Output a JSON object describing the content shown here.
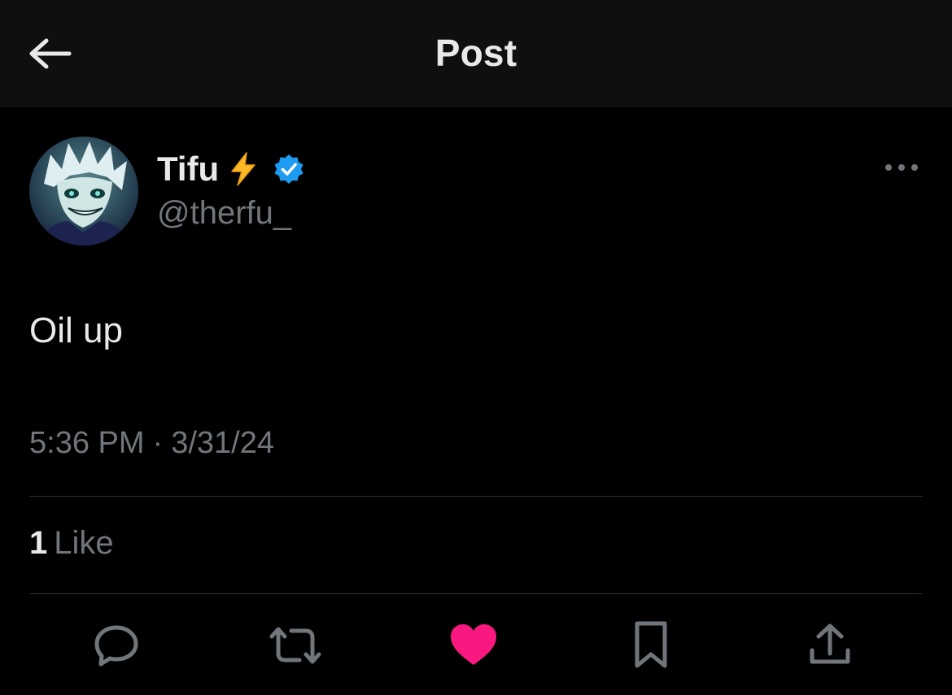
{
  "header": {
    "title": "Post",
    "back_icon": "arrow-left-icon"
  },
  "author": {
    "display_name": "Tifu",
    "emoji": "⚡",
    "verified": true,
    "handle": "@therfu_",
    "avatar": "anime-character-avatar"
  },
  "post": {
    "text": "Oil up",
    "time": "5:36 PM",
    "separator": "·",
    "date": "3/31/24"
  },
  "engagement": {
    "likes_count": "1",
    "likes_label": "Like",
    "liked": true
  },
  "actions": {
    "icons": [
      "reply-icon",
      "repost-icon",
      "like-icon",
      "bookmark-icon",
      "share-icon"
    ]
  },
  "colors": {
    "background": "#000000",
    "header_background": "#0f0f0f",
    "primary_text": "#e7e9ea",
    "secondary_text": "#71767b",
    "divider": "#2f3336",
    "verified_blue": "#1d9bf0",
    "like_pink": "#f91880"
  }
}
